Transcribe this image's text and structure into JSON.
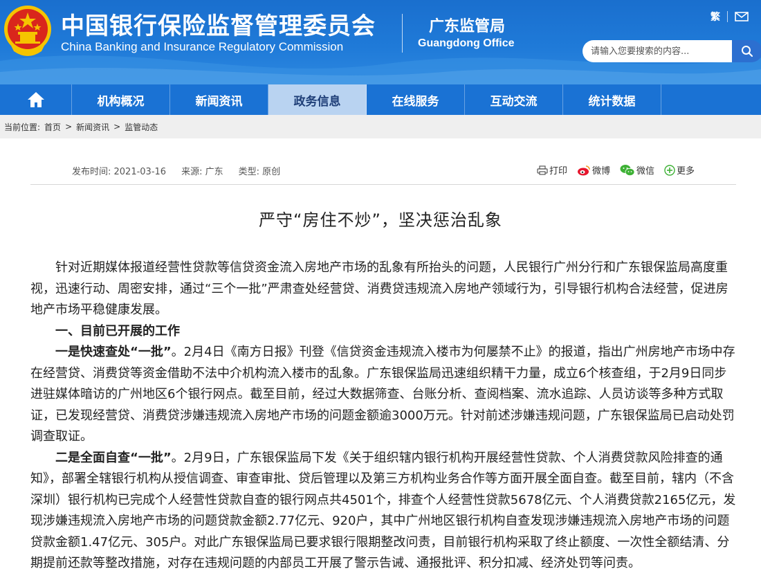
{
  "header": {
    "title_cn": "中国银行保险监督管理委员会",
    "title_en": "China Banking and Insurance Regulatory Commission",
    "office_cn": "广东监管局",
    "office_en": "Guangdong Office",
    "tool_fan": "繁",
    "search_placeholder": "请输入您要搜索的内容..."
  },
  "nav": {
    "home_icon": "home-icon",
    "items": [
      {
        "label": "机构概况"
      },
      {
        "label": "新闻资讯"
      },
      {
        "label": "政务信息",
        "active": true
      },
      {
        "label": "在线服务"
      },
      {
        "label": "互动交流"
      },
      {
        "label": "统计数据"
      }
    ]
  },
  "breadcrumb": {
    "label": "当前位置:",
    "items": [
      "首页",
      "新闻资讯",
      "监管动态"
    ],
    "sep": ">"
  },
  "meta": {
    "date": "发布时间: 2021-03-16",
    "source": "来源: 广东",
    "type": "类型: 原创"
  },
  "share": {
    "print": "打印",
    "weibo": "微博",
    "wechat": "微信",
    "more": "更多"
  },
  "article": {
    "title": "严守“房住不炒”，坚决惩治乱象",
    "p1": "针对近期媒体报道经营性贷款等信贷资金流入房地产市场的乱象有所抬头的问题，人民银行广州分行和广东银保监局高度重视，迅速行动、周密安排，通过“三个一批”严肃查处经营贷、消费贷违规流入房地产领域行为，引导银行机构合法经营，促进房地产市场平稳健康发展。",
    "h1": "一、目前已开展的工作",
    "p2_lead": "一是快速查处“一批”",
    "p2": "。2月4日《南方日报》刊登《信贷资金违规流入楼市为何屡禁不止》的报道，指出广州房地产市场中存在经营贷、消费贷等资金借助不法中介机构流入楼市的乱象。广东银保监局迅速组织精干力量，成立6个核查组，于2月9日同步进驻媒体暗访的广州地区6个银行网点。截至目前，经过大数据筛查、台账分析、查阅档案、流水追踪、人员访谈等多种方式取证，已发现经营贷、消费贷涉嫌违规流入房地产市场的问题金额逾3000万元。针对前述涉嫌违规问题，广东银保监局已启动处罚调查取证。",
    "p3_lead": "二是全面自查“一批”",
    "p3": "。2月9日，广东银保监局下发《关于组织辖内银行机构开展经营性贷款、个人消费贷款风险排查的通知》，部署全辖银行机构从授信调查、审查审批、贷后管理以及第三方机构业务合作等方面开展全面自查。截至目前，辖内（不含深圳）银行机构已完成个人经营性贷款自查的银行网点共4501个，排查个人经营性贷款5678亿元、个人消费贷款2165亿元，发现涉嫌违规流入房地产市场的问题贷款金额2.77亿元、920户，其中广州地区银行机构自查发现涉嫌违规流入房地产市场的问题贷款金额1.47亿元、305户。对此广东银保监局已要求银行限期整改问责，目前银行机构采取了终止额度、一次性全额结清、分期提前还款等整改措施，对存在违规问题的内部员工开展了警示告诫、通报批评、积分扣减、经济处罚等问责。"
  },
  "colors": {
    "header_blue": "#1f7ad8",
    "nav_blue": "#1a72d4",
    "nav_active_bg": "#b9d3f1",
    "emblem_red": "#d9261c",
    "emblem_gold": "#f5c400"
  }
}
